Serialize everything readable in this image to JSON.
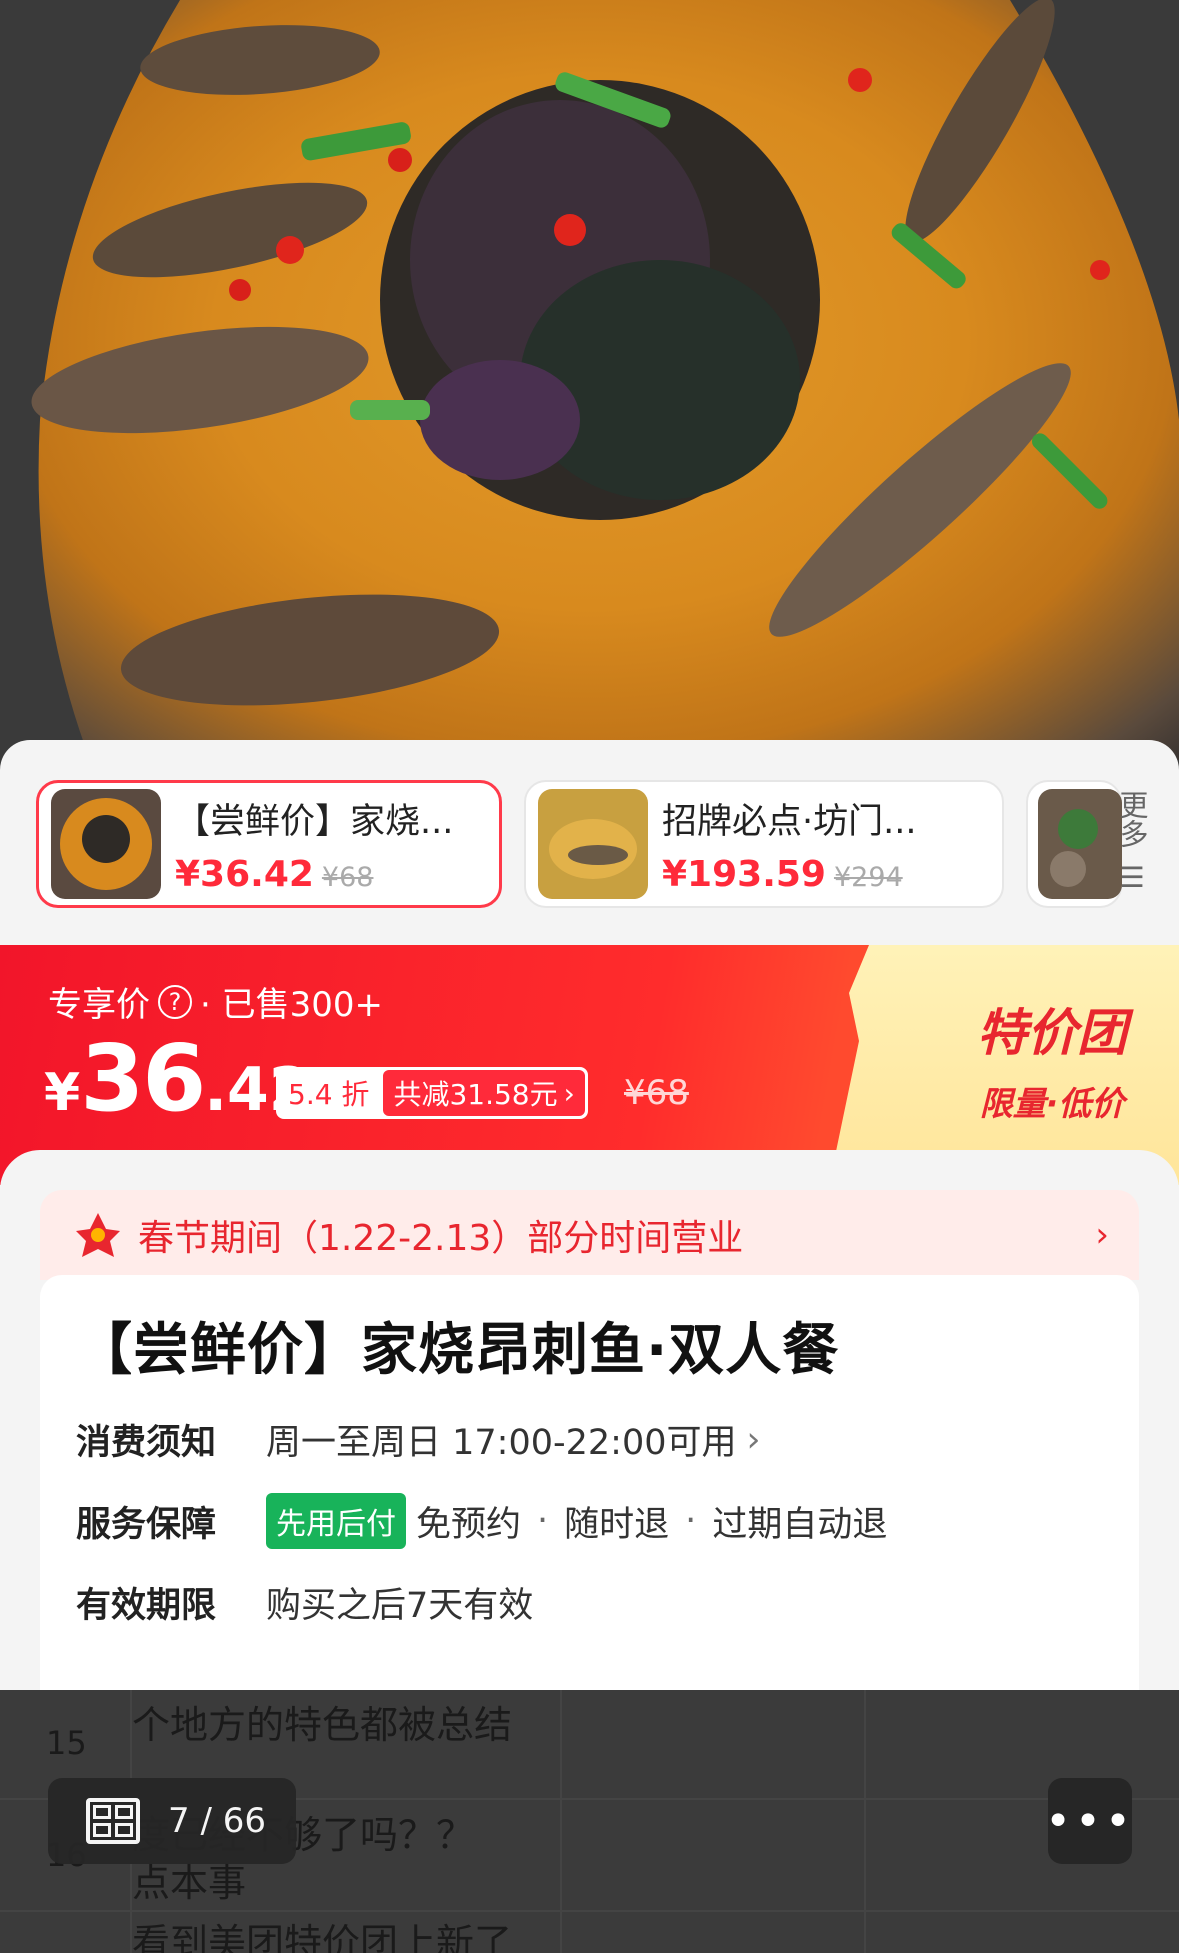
{
  "deals": [
    {
      "title": "【尝鲜价】家烧...",
      "price": "¥36.42",
      "old_price": "¥68"
    },
    {
      "title": "招牌必点·坊门...",
      "price": "¥193.59",
      "old_price": "¥294"
    }
  ],
  "more_label": "更多",
  "promo": {
    "line": "专享价",
    "sold": "· 已售300+",
    "currency": "¥",
    "price_int": "36",
    "price_dec": ".42",
    "discount": "5.4 折",
    "save": "共减31.58元",
    "old_price": "¥68",
    "badge_title": "特价团",
    "badge_sub": "限量·低价"
  },
  "notice": {
    "text": "春节期间（1.22-2.13）部分时间营业"
  },
  "product": {
    "title": "【尝鲜价】家烧昂刺鱼·双人餐",
    "rows": [
      {
        "label": "消费须知",
        "value": "周一至周日 17:00-22:00可用"
      },
      {
        "label": "服务保障",
        "tag": "先用后付",
        "items": [
          "免预约",
          "随时退",
          "过期自动退"
        ]
      },
      {
        "label": "有效期限",
        "value": "购买之后7天有效"
      }
    ]
  },
  "overlay": {
    "rows": [
      {
        "num": "15",
        "text": "个地方的特色都被总结"
      },
      {
        "num": "16",
        "text": "度已经不够了吗？？"
      },
      {
        "num": "",
        "text": "点本事"
      },
      {
        "num": "",
        "text": "看到美团特价团上新了"
      }
    ]
  },
  "viewer": {
    "counter": "7 / 66"
  },
  "colors": {
    "accent": "#ff2a3a",
    "green": "#18b35a",
    "badge": "#e8262f"
  }
}
